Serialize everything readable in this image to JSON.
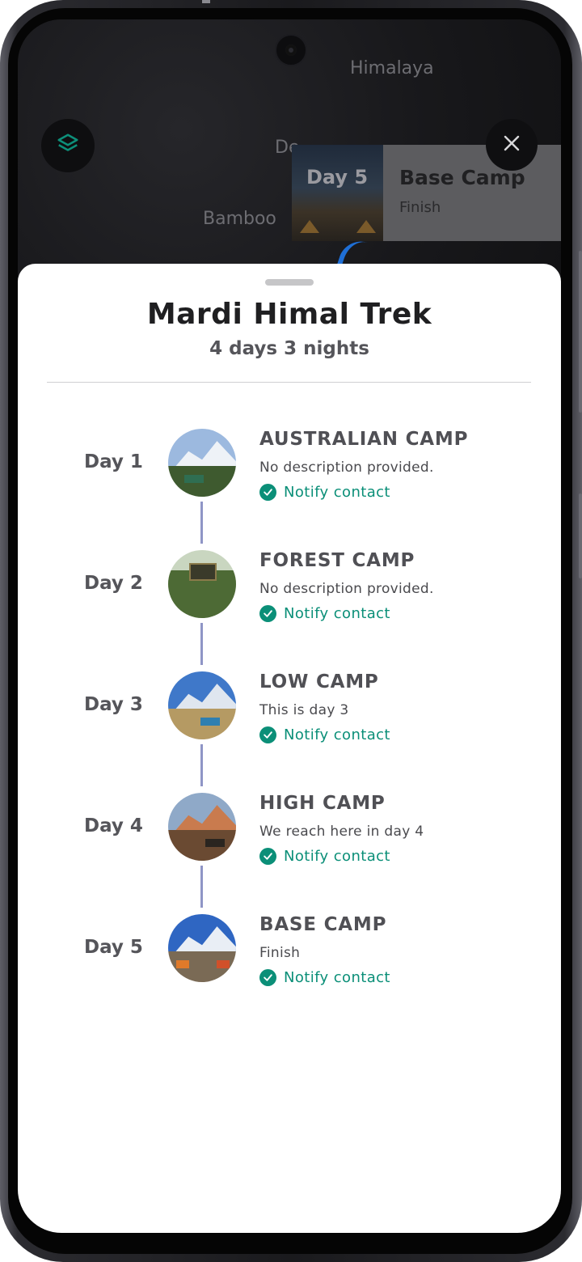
{
  "map": {
    "labels": {
      "himalaya": "Himalaya",
      "deurali": "De",
      "bamboo": "Bamboo"
    },
    "icons": {
      "layers": "layers-icon",
      "close": "close-icon"
    },
    "route_color": "#1f6fd6"
  },
  "day_card": {
    "day": "Day 5",
    "title": "Base Camp",
    "subtitle": "Finish"
  },
  "sheet": {
    "title": "Mardi Himal Trek",
    "subtitle": "4 days 3 nights",
    "itinerary": [
      {
        "day": "Day 1",
        "title": "AUSTRALIAN CAMP",
        "description": "No description provided.",
        "notify": "Notify contact"
      },
      {
        "day": "Day 2",
        "title": "FOREST CAMP",
        "description": "No description provided.",
        "notify": "Notify contact"
      },
      {
        "day": "Day 3",
        "title": "LOW CAMP",
        "description": "This is day 3",
        "notify": "Notify contact"
      },
      {
        "day": "Day 4",
        "title": "HIGH CAMP",
        "description": "We reach here in day 4",
        "notify": "Notify contact"
      },
      {
        "day": "Day 5",
        "title": "BASE CAMP",
        "description": "Finish",
        "notify": "Notify contact"
      }
    ]
  },
  "colors": {
    "accent": "#0b8f78",
    "timeline": "#8f95c6"
  }
}
